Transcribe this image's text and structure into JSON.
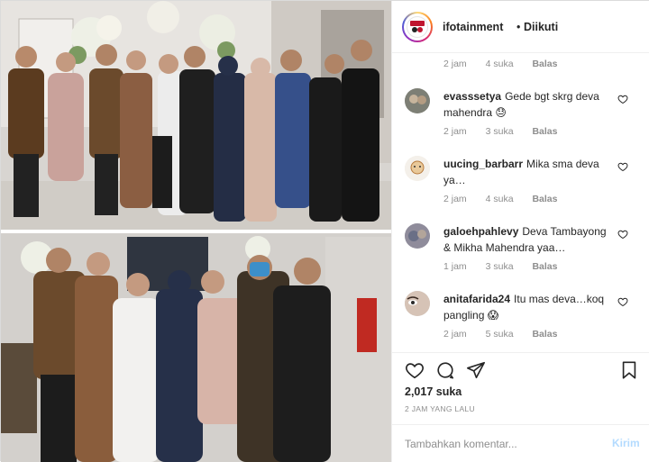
{
  "post": {
    "photo_alt": "",
    "account": "ifotainment",
    "separator": "•",
    "follow_state": "Diikuti"
  },
  "top_meta": {
    "time": "2 jam",
    "likes": "4 suka",
    "reply": "Balas"
  },
  "comments": [
    {
      "user": "evasssetya",
      "text": "Gede bgt skrg deva mahendra 😓",
      "time": "2 jam",
      "likes": "3 suka",
      "reply": "Balas"
    },
    {
      "user": "uucing_barbarr",
      "text": "Mika sma deva ya…",
      "time": "2 jam",
      "likes": "4 suka",
      "reply": "Balas"
    },
    {
      "user": "galoehpahlevy",
      "text": "Deva Tambayong & Mikha Mahendra yaa…",
      "time": "1 jam",
      "likes": "3 suka",
      "reply": "Balas"
    },
    {
      "user": "anitafarida24",
      "text": "Itu mas deva…koq pangling 😱",
      "time": "2 jam",
      "likes": "5 suka",
      "reply": "Balas"
    }
  ],
  "actions": {
    "like_icon": "heart-icon",
    "comment_icon": "comment-bubble-icon",
    "share_icon": "paper-plane-icon",
    "save_icon": "bookmark-icon"
  },
  "likes_count": "2,017 suka",
  "timestamp": "2 JAM YANG LALU",
  "add_comment": {
    "placeholder": "Tambahkan komentar...",
    "post_label": "Kirim"
  },
  "colors": {
    "link_disabled": "#b3dbff",
    "muted": "#8e8e8e",
    "border": "#efefef"
  }
}
